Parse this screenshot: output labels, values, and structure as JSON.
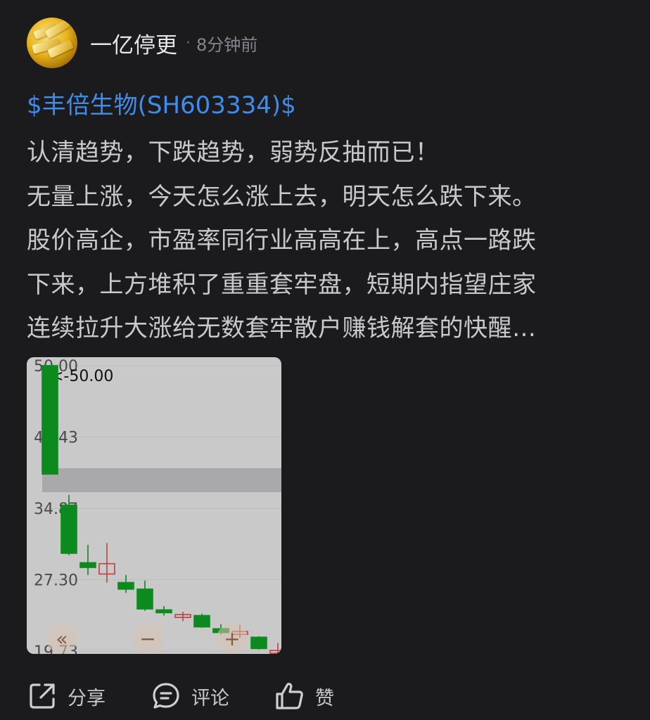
{
  "post": {
    "author": "一亿停更",
    "separator": "·",
    "time": "8分钟前",
    "stock_link": "$丰倍生物(SH603334)$",
    "lines": [
      "认清趋势，下跌趋势，弱势反抽而已！",
      "无量上涨，今天怎么涨上去，明天怎么跌下来。",
      "股价高企，市盈率同行业高高在上，高点一路跌",
      "下来，上方堆积了重重套牢盘，短期内指望庄家",
      "连续拉升大涨给无数套牢散户赚钱解套的快醒…"
    ]
  },
  "chart_data": {
    "type": "candlestick",
    "y_tick_labels": [
      "50.00",
      "42.43",
      "34.87",
      "27.30",
      "19.73"
    ],
    "ylim": [
      19.73,
      50.0
    ],
    "max_marker": "<-50.00",
    "colors": {
      "down": "#0d8a1e",
      "up": "#c0413d",
      "background": "#c9c9c9",
      "band": "#a9a9ab"
    },
    "candles": [
      {
        "open": 50.0,
        "close": 38.5,
        "high": 50.0,
        "low": 38.5
      },
      {
        "open": 35.2,
        "close": 30.1,
        "high": 36.3,
        "low": 29.9
      },
      {
        "open": 29.1,
        "close": 28.6,
        "high": 31.0,
        "low": 27.8
      },
      {
        "open": 27.9,
        "close": 29.0,
        "high": 31.2,
        "low": 27.0
      },
      {
        "open": 27.0,
        "close": 26.3,
        "high": 27.8,
        "low": 25.9
      },
      {
        "open": 26.3,
        "close": 24.2,
        "high": 27.2,
        "low": 24.0
      },
      {
        "open": 24.1,
        "close": 23.8,
        "high": 24.5,
        "low": 23.5
      },
      {
        "open": 23.3,
        "close": 23.6,
        "high": 23.9,
        "low": 22.9
      },
      {
        "open": 23.5,
        "close": 22.3,
        "high": 23.7,
        "low": 22.2
      },
      {
        "open": 22.1,
        "close": 21.7,
        "high": 22.6,
        "low": 21.5
      },
      {
        "open": 21.5,
        "close": 21.8,
        "high": 22.5,
        "low": 21.1
      },
      {
        "open": 21.2,
        "close": 20.0,
        "high": 21.3,
        "low": 19.9
      },
      {
        "open": 19.5,
        "close": 19.8,
        "high": 20.6,
        "low": 19.2
      }
    ],
    "controls": [
      "«",
      "−",
      "+"
    ]
  },
  "actions": {
    "share_label": "分享",
    "comment_label": "评论",
    "like_label": "赞"
  }
}
